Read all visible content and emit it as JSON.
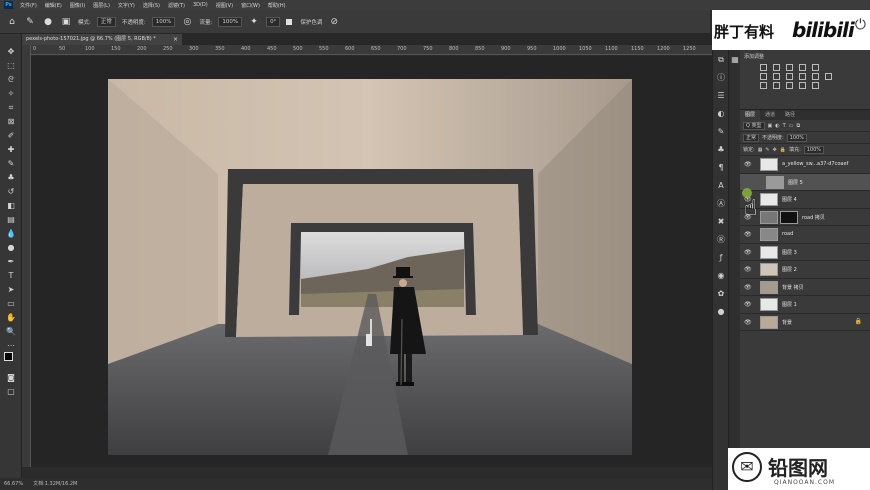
{
  "menu": [
    "文件(F)",
    "编辑(E)",
    "图像(I)",
    "图层(L)",
    "文字(Y)",
    "选择(S)",
    "滤镜(T)",
    "3D(D)",
    "视图(V)",
    "窗口(W)",
    "帮助(H)"
  ],
  "options": {
    "mode_label": "模式:",
    "mode_value": "正常",
    "opacity_label": "不透明度:",
    "opacity_value": "100%",
    "flow_label": "流量:",
    "flow_value": "100%",
    "smoothing": "0°",
    "protect_label": "保护色调"
  },
  "watermark_top": {
    "text_cn": "胖丁有料",
    "text_brand": "bilibili"
  },
  "document_tab": {
    "label": "pexels-photo-157021.jpg @ 66.7% (图层 5, RGB/8) *",
    "close": "×"
  },
  "ruler_ticks": [
    "0",
    "50",
    "100",
    "150",
    "200",
    "250",
    "300",
    "350",
    "400",
    "450",
    "500",
    "550",
    "600",
    "650",
    "700",
    "750",
    "800",
    "850",
    "900",
    "950",
    "1000",
    "1050",
    "1100",
    "1150",
    "1200",
    "1250"
  ],
  "status": {
    "zoom": "66.67%",
    "doc": "文档:1.32M/16.2M"
  },
  "adjustments": {
    "title": "添加调整"
  },
  "layers_panel": {
    "tabs": [
      "图层",
      "通道",
      "路径"
    ],
    "kind_label": "Q 类型",
    "blend_mode": "正常",
    "opacity_label": "不透明度:",
    "opacity_value": "100%",
    "lock_label": "锁定:",
    "fill_label": "填充:",
    "fill_value": "100%",
    "layers": [
      {
        "name": "a_yellow_sw...a37-d7coaef",
        "mask": false,
        "selected": false
      },
      {
        "name": "图层 5",
        "mask": false,
        "selected": true
      },
      {
        "name": "图层 4",
        "mask": false,
        "selected": false
      },
      {
        "name": "road 拷贝",
        "mask": true,
        "selected": false
      },
      {
        "name": "road",
        "mask": false,
        "selected": false
      },
      {
        "name": "图层 3",
        "mask": false,
        "selected": false
      },
      {
        "name": "图层 2",
        "mask": false,
        "selected": false
      },
      {
        "name": "背景 拷贝",
        "mask": false,
        "selected": false
      },
      {
        "name": "图层 1",
        "mask": false,
        "selected": false
      },
      {
        "name": "背景",
        "mask": false,
        "selected": false
      }
    ]
  },
  "watermark_bottom": {
    "text_cn": "铅图网",
    "text_en": "QIANOOAN.COM"
  }
}
